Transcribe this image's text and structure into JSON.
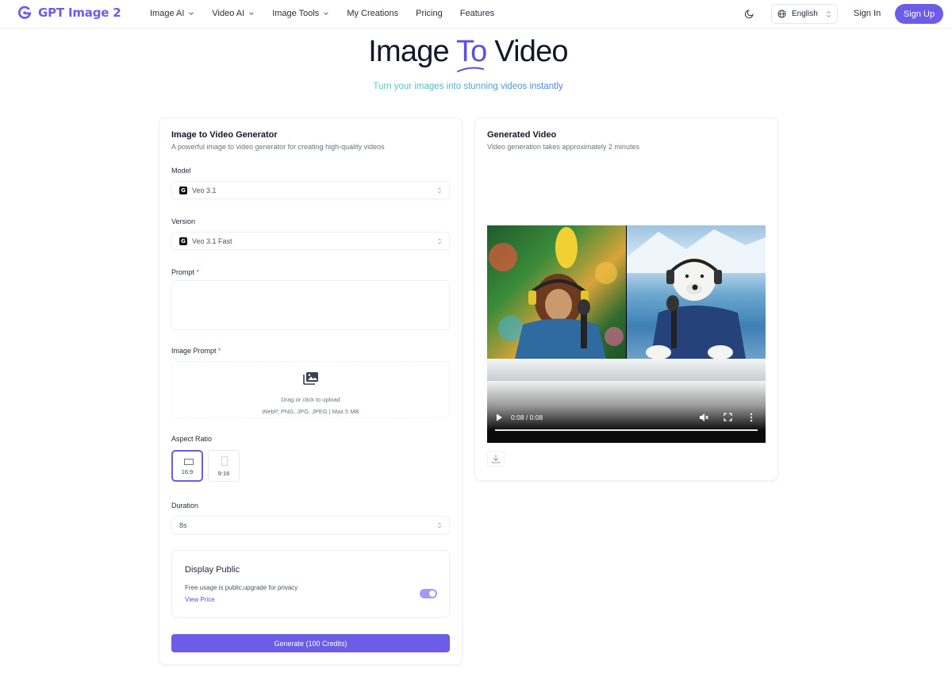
{
  "brand": {
    "name": "GPT Image 2",
    "accent": "#6c5ce7"
  },
  "nav": {
    "items": [
      {
        "label": "Image AI",
        "dropdown": true
      },
      {
        "label": "Video AI",
        "dropdown": true
      },
      {
        "label": "Image Tools",
        "dropdown": true
      },
      {
        "label": "My Creations",
        "dropdown": false
      },
      {
        "label": "Pricing",
        "dropdown": false
      },
      {
        "label": "Features",
        "dropdown": false
      }
    ],
    "language": "English",
    "sign_in": "Sign In",
    "sign_up": "Sign Up"
  },
  "hero": {
    "title_pre": "Image ",
    "title_accent": "To",
    "title_post": " Video",
    "subtitle": "Turn your images into stunning videos instantly"
  },
  "generator": {
    "title": "Image to Video Generator",
    "subtitle": "A powerful image to video generator for creating high-quality videos",
    "model_label": "Model",
    "model_value": "Veo 3.1",
    "version_label": "Version",
    "version_value": "Veo 3.1 Fast",
    "prompt_label": "Prompt",
    "prompt_value": "",
    "image_prompt_label": "Image Prompt",
    "required_mark": "*",
    "upload_text": "Drag or click to upload",
    "upload_formats": "WebP, PNG, JPG, JPEG | Max 5 MB",
    "aspect_label": "Aspect Ratio",
    "aspect_options": [
      {
        "label": "16:9",
        "selected": true
      },
      {
        "label": "9:16",
        "selected": false
      }
    ],
    "duration_label": "Duration",
    "duration_value": "8s",
    "public": {
      "title": "Display Public",
      "description": "Free usage is public,upgrade for privacy",
      "link": "View Price",
      "enabled": true
    },
    "generate_button": "Generate (100 Credits)"
  },
  "result": {
    "title": "Generated Video",
    "subtitle": "Video generation takes approximately 2 minutes",
    "video_time": "0:08 / 0:08",
    "video_progress": 1.0
  }
}
